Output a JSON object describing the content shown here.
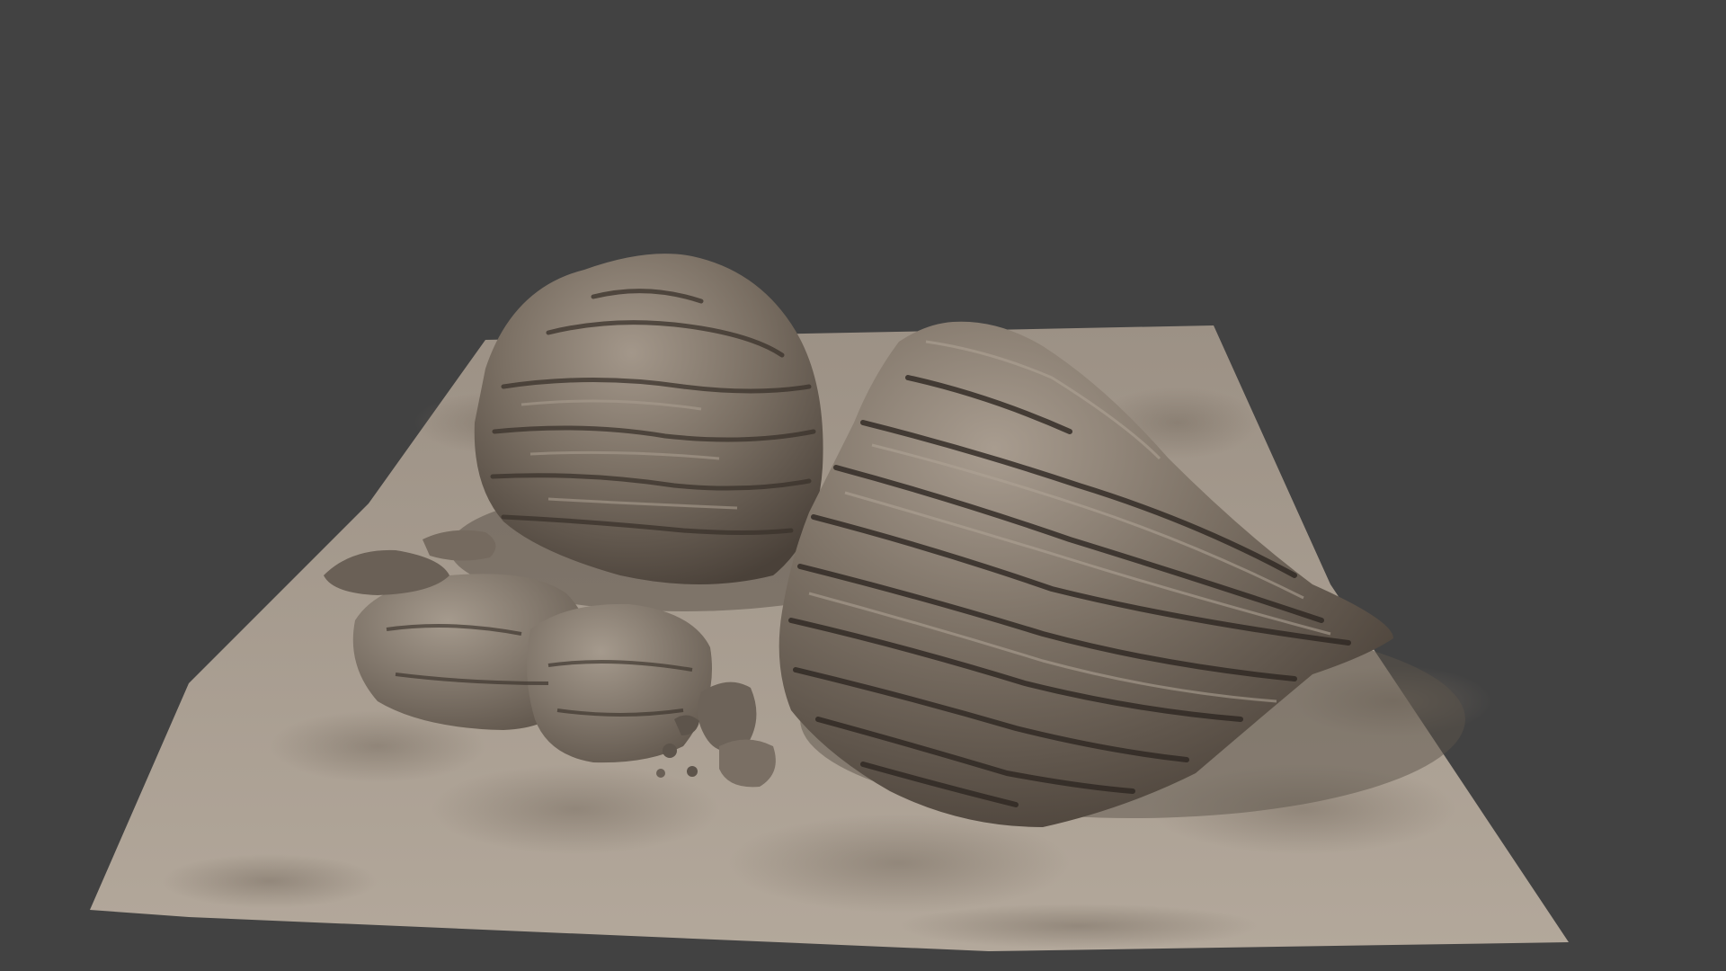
{
  "viewport": {
    "background_color": "#424242"
  },
  "scene": {
    "subject": "rock-formation-model",
    "colors": {
      "ground": "#a59a8e",
      "ground_shadow": "#7d7267",
      "rock_light": "#9d9184",
      "rock_mid": "#6e6358",
      "rock_dark": "#3b342e",
      "rock_crack": "#2a2420"
    }
  }
}
